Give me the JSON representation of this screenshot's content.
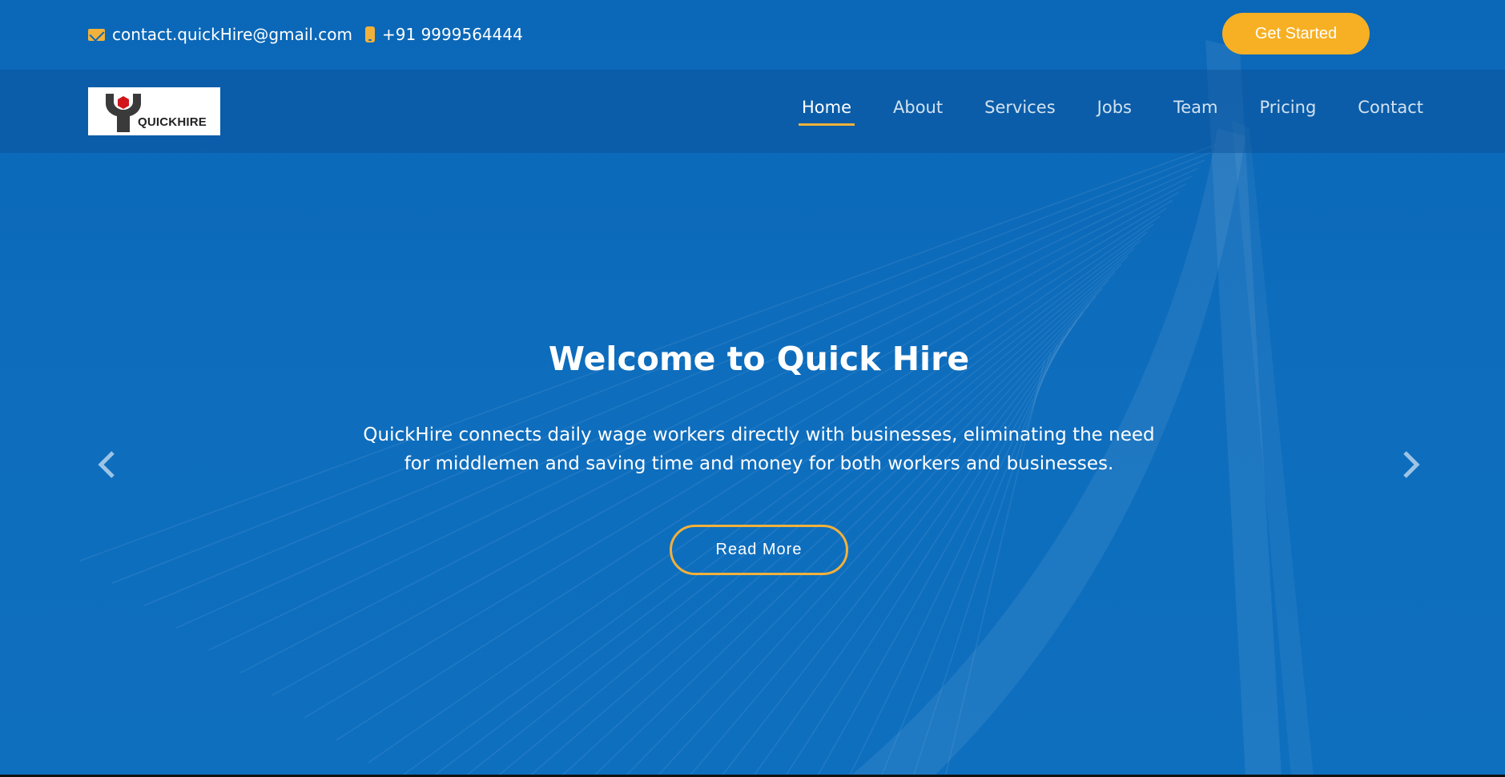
{
  "topbar": {
    "email": "contact.quickHire@gmail.com",
    "email_icon": "envelope-icon",
    "phone": "+91 9999564444",
    "phone_icon": "mobile-phone-icon",
    "cta_label": "Get Started"
  },
  "logo": {
    "text": "QUICKHIRE",
    "icon": "wrench-hexagon-logo"
  },
  "nav": {
    "items": [
      {
        "label": "Home",
        "active": true
      },
      {
        "label": "About"
      },
      {
        "label": "Services"
      },
      {
        "label": "Jobs"
      },
      {
        "label": "Team"
      },
      {
        "label": "Pricing"
      },
      {
        "label": "Contact"
      }
    ]
  },
  "hero": {
    "title": "Welcome to Quick Hire",
    "description": "QuickHire connects daily wage workers directly with businesses, eliminating the need for middlemen and saving time and money for both workers and businesses.",
    "button_label": "Read More",
    "prev_icon": "chevron-left-icon",
    "next_icon": "chevron-right-icon"
  },
  "colors": {
    "background": "#0d6bbb",
    "accent": "#f7b023",
    "nav_bar": "#0a5a9f"
  }
}
